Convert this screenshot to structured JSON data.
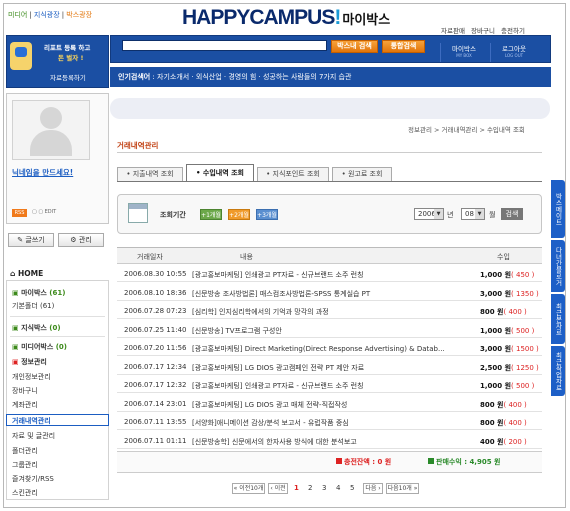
{
  "top_links": [
    "미디어",
    "지식광장",
    "박스광장"
  ],
  "logo": {
    "text": "HAPPYCAMPUS",
    "mark": "!",
    "suffix": "마이박스"
  },
  "top_right_links": [
    "자료판매",
    "장바구니",
    "충전하기"
  ],
  "search": {
    "placeholder": "",
    "btn_mybox": "박스내 검색",
    "btn_all": "통합검색"
  },
  "nav": [
    {
      "label": "마이박스",
      "sub": "MY BOX"
    },
    {
      "label": "로그아웃",
      "sub": "LOG OUT"
    }
  ],
  "promo": {
    "line1": "리포트 등록 하고",
    "line2": "돈 벌자 !",
    "link": "자료등록하기"
  },
  "popular": {
    "label": "인기검색어",
    "items": "자기소개서 · 외식산업 · 경영의 힘 · 성공하는 사람들의 7가지 습관"
  },
  "profile": {
    "nickname": "닉네임을 만드세요!",
    "rss": "RSS",
    "icons": "▢ ▢ EDIT"
  },
  "buttons": {
    "write": "글쓰기",
    "manage": "관리"
  },
  "menu": {
    "home": "HOME",
    "mybox": {
      "label": "마이박스",
      "count": "(61)"
    },
    "basic_box": "기본폴더 (61)",
    "knowledge": {
      "label": "지식박스",
      "count": "(0)"
    },
    "media": {
      "label": "미디어박스",
      "count": "(0)"
    },
    "items": [
      "정보관리",
      "개인정보관리",
      "장바구니",
      "계좌관리",
      "거래내역관리",
      "자료 및 글관리",
      "폴더관리",
      "그룹관리",
      "즐겨찾기/RSS",
      "스킨관리"
    ]
  },
  "right_tabs": [
    "박스메이트",
    "다녀간블로거",
    "최근본자료",
    "최근작업자료"
  ],
  "breadcrumb": "정보관리 > 거래내역관리 > 수입내역 조회",
  "page_title": "거래내역관리",
  "tabs": [
    "지출내역 조회",
    "수입내역 조회",
    "지식포인트 조회",
    "원고료 조회"
  ],
  "period": {
    "label": "조회기간",
    "buttons": [
      "1개월",
      "2개월",
      "3개월"
    ],
    "year": "2006",
    "year_unit": "년",
    "month": "08",
    "month_unit": "월",
    "search_btn": "검색"
  },
  "table": {
    "headers": [
      "거래일자",
      "내용",
      "수입"
    ],
    "rows": [
      {
        "date": "2006.08.30 10:55",
        "content": "[광고홍보마케팅] 인쇄광고 PT자료 - 신규브랜드 소주 런칭",
        "amount": "1,000 원",
        "points": "( 450 )"
      },
      {
        "date": "2006.08.10 18:36",
        "content": "[신문방송 조사방법론] 매스컴조사방법론-SPSS 통계실습 PT",
        "amount": "3,000 원",
        "points": "( 1350 )"
      },
      {
        "date": "2006.07.28 07:23",
        "content": "[심리학] 인지심리학에서의 기억과 망각의 과정",
        "amount": "800 원",
        "points": "( 400 )"
      },
      {
        "date": "2006.07.25 11:40",
        "content": "[신문방송] TV프로그램 구성안",
        "amount": "1,000 원",
        "points": "( 500 )"
      },
      {
        "date": "2006.07.20 11:56",
        "content": "[광고홍보마케팅] Direct Marketing(Direct Response Advertising) & Datab...",
        "amount": "3,000 원",
        "points": "( 1500 )"
      },
      {
        "date": "2006.07.17 12:34",
        "content": "[광고홍보마케팅] LG DIOS 광고캠페인 전략 PT 제안 자료",
        "amount": "2,500 원",
        "points": "( 1250 )"
      },
      {
        "date": "2006.07.17 12:32",
        "content": "[광고홍보마케팅] 인쇄광고 PT자료 - 신규브랜드 소주 런칭",
        "amount": "1,000 원",
        "points": "( 500 )"
      },
      {
        "date": "2006.07.14 23:01",
        "content": "[광고홍보마케팅] LG DIOS 광고 매체 전략-직접작성",
        "amount": "800 원",
        "points": "( 400 )"
      },
      {
        "date": "2006.07.11 13:55",
        "content": "[서양화]애니메이션 감상/분석 보고서 - 유럽작품 중심",
        "amount": "800 원",
        "points": "( 400 )"
      },
      {
        "date": "2006.07.11 01:11",
        "content": "[신문방송학] 신문에서의 한자사용 방식에 대한 분석보고",
        "amount": "400 원",
        "points": "( 200 )"
      }
    ]
  },
  "summary": {
    "balance_label": "충전잔액 :",
    "balance_value": "0 원",
    "sales_label": "판매수익 :",
    "sales_value": "4,905 원"
  },
  "pager": {
    "prev10": "이전10개",
    "prev": "이전",
    "pages": [
      "1",
      "2",
      "3",
      "4",
      "5"
    ],
    "next": "다음",
    "next10": "다음10개"
  },
  "colors": {
    "brand_blue": "#1b4fa3",
    "accent_orange": "#e2750b",
    "points_red": "#d22222",
    "title_orange": "#c24316"
  }
}
